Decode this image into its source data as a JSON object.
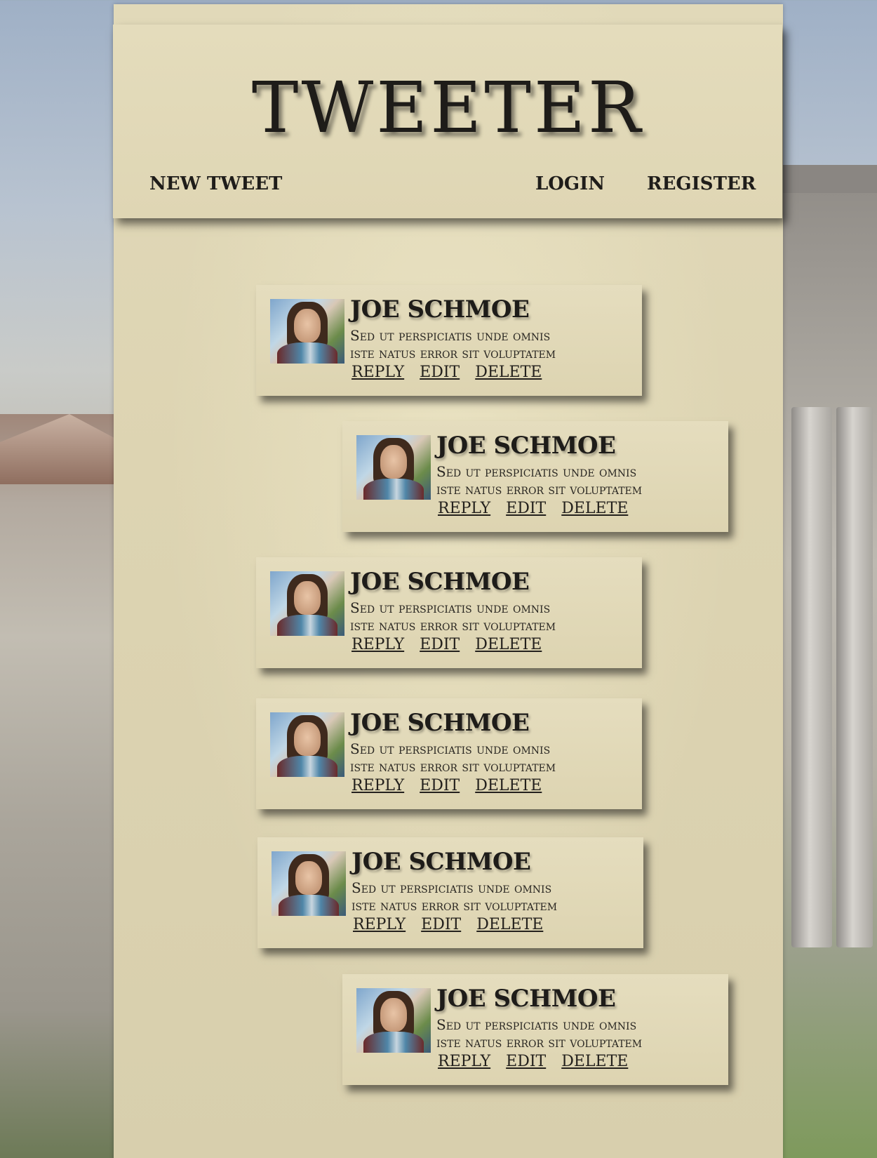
{
  "header": {
    "title": "TWEETER",
    "nav_left": "NEW TWEET",
    "nav_login": "LOGIN",
    "nav_register": "REGISTER"
  },
  "tweets": [
    {
      "author": "JOE SCHMOE",
      "line1": "Sed ut perspiciatis unde omnis",
      "line2": "iste natus error sit voluptatem",
      "reply": "REPLY",
      "edit": "EDIT",
      "delete": "DELETE"
    },
    {
      "author": "JOE SCHMOE",
      "line1": "Sed ut perspiciatis unde omnis",
      "line2": "iste natus error sit voluptatem",
      "reply": "REPLY",
      "edit": "EDIT",
      "delete": "DELETE"
    },
    {
      "author": "JOE SCHMOE",
      "line1": "Sed ut perspiciatis unde omnis",
      "line2": "iste natus error sit voluptatem",
      "reply": "REPLY",
      "edit": "EDIT",
      "delete": "DELETE"
    },
    {
      "author": "JOE SCHMOE",
      "line1": "Sed ut perspiciatis unde omnis",
      "line2": "iste natus error sit voluptatem",
      "reply": "REPLY",
      "edit": "EDIT",
      "delete": "DELETE"
    },
    {
      "author": "JOE SCHMOE",
      "line1": "Sed ut perspiciatis unde omnis",
      "line2": "iste natus error sit voluptatem",
      "reply": "REPLY",
      "edit": "EDIT",
      "delete": "DELETE"
    },
    {
      "author": "JOE SCHMOE",
      "line1": "Sed ut perspiciatis unde omnis",
      "line2": "iste natus error sit voluptatem",
      "reply": "REPLY",
      "edit": "EDIT",
      "delete": "DELETE"
    }
  ],
  "colors": {
    "parchment": "#ddd4b2",
    "ink": "#1e1c19"
  },
  "icons": {
    "avatar": "user-avatar-image"
  }
}
